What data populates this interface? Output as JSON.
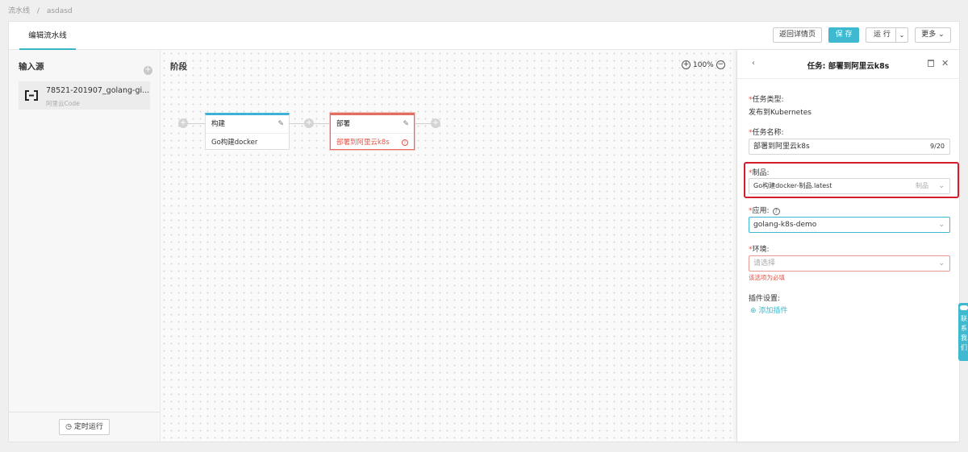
{
  "breadcrumb": [
    "流水线",
    "asdasd"
  ],
  "header": {
    "tab_label": "编辑流水线",
    "back_label": "返回详情页",
    "save_label": "保 存",
    "run_label": "运 行",
    "more_label": "更多"
  },
  "sources": {
    "title": "输入源",
    "item_name": "78521-201907_golang-gi...",
    "item_type": "阿里云Code",
    "timed_run_label": "定时运行"
  },
  "canvas": {
    "title": "阶段",
    "zoom": "100%",
    "jobs": [
      {
        "title": "构建",
        "task": "Go构建docker"
      },
      {
        "title": "部署",
        "task": "部署到阿里云k8s"
      }
    ]
  },
  "task_panel": {
    "title": "任务: 部署到阿里云k8s",
    "type_label": "任务类型:",
    "type_value": "发布到Kubernetes",
    "name_label": "任务名称:",
    "name_value": "部署到阿里云k8s",
    "name_count": "9/20",
    "artifact_label": "制品:",
    "artifact_value": "Go构建docker-制品.latest",
    "artifact_hint": "制品",
    "app_label": "应用:",
    "app_value": "golang-k8s-demo",
    "env_label": "环境:",
    "env_placeholder": "请选择",
    "env_error": "该选项为必填",
    "plugin_label": "插件设置:",
    "add_plugin": "添加插件"
  },
  "side_tab": [
    "联",
    "系",
    "我",
    "们"
  ],
  "colors": {
    "accent": "#3eb9cf",
    "error": "#e0574a",
    "highlight": "#d01e2c"
  }
}
